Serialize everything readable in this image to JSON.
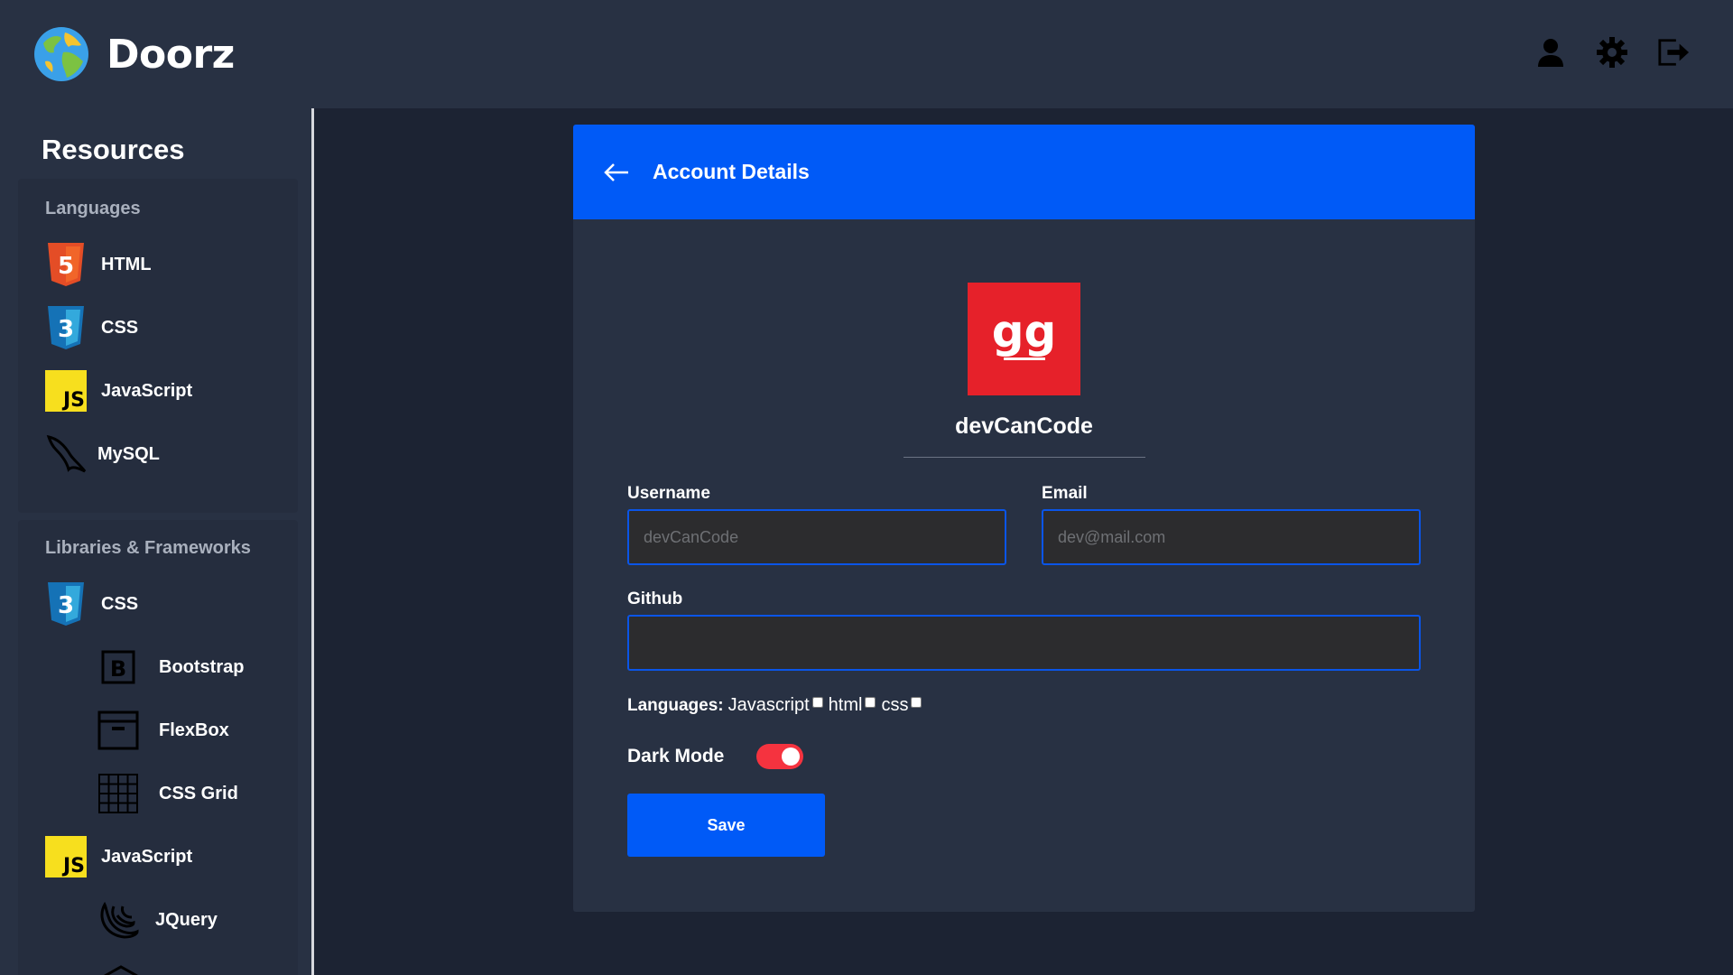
{
  "app": {
    "name": "Doorz"
  },
  "topbar": {
    "icons": [
      "user-icon",
      "gear-icon",
      "logout-icon"
    ]
  },
  "sidebar": {
    "title": "Resources",
    "languages": {
      "heading": "Languages",
      "items": [
        {
          "label": "HTML",
          "icon": "html5-icon"
        },
        {
          "label": "CSS",
          "icon": "css3-icon"
        },
        {
          "label": "JavaScript",
          "icon": "javascript-icon"
        },
        {
          "label": "MySQL",
          "icon": "mysql-dolphin-icon"
        }
      ]
    },
    "frameworks": {
      "heading": "Libraries & Frameworks",
      "items": [
        {
          "label": "CSS",
          "icon": "css3-icon"
        },
        {
          "label": "Bootstrap",
          "icon": "bootstrap-icon"
        },
        {
          "label": "FlexBox",
          "icon": "flexbox-icon"
        },
        {
          "label": "CSS Grid",
          "icon": "grid-icon"
        },
        {
          "label": "JavaScript",
          "icon": "javascript-icon"
        },
        {
          "label": "JQuery",
          "icon": "jquery-icon"
        }
      ]
    }
  },
  "card": {
    "title": "Account Details",
    "avatar_text": "gg",
    "profile_name": "devCanCode",
    "fields": {
      "username_label": "Username",
      "username_placeholder": "devCanCode",
      "email_label": "Email",
      "email_placeholder": "dev@mail.com",
      "github_label": "Github",
      "github_value": ""
    },
    "languages": {
      "label": "Languages:",
      "options": [
        "Javascript",
        "html",
        "css"
      ]
    },
    "dark_mode": {
      "label": "Dark Mode",
      "enabled": true
    },
    "save_label": "Save"
  },
  "colors": {
    "accent": "#005af7",
    "toggle_on": "#f5333f",
    "avatar_bg": "#e6212a",
    "background": "#1c2333",
    "panel": "#283143"
  }
}
